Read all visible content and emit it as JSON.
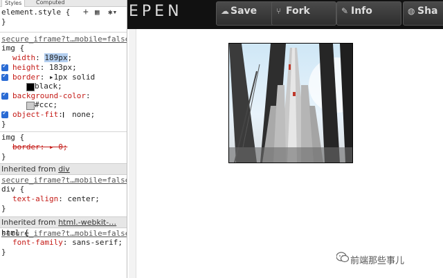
{
  "devtools": {
    "tabs": [
      "Styles",
      "Computed"
    ],
    "element_style": "element.style {",
    "icons": [
      "add-rule-icon",
      "toggle-state-icon",
      "settings-icon"
    ],
    "rule1": {
      "source": "secure_iframe?t…mobile=false",
      "selector": "img {",
      "width_prop": "width",
      "width_val": "189px",
      "height_prop": "height",
      "height_val": "183px;",
      "border_prop": "border",
      "border_val": "1px solid",
      "border_val2": "black;",
      "bg_prop": "background-color",
      "bg_val": "#ccc;",
      "fit_prop": "object-fit",
      "fit_val": "none;",
      "close": "}"
    },
    "rule2": {
      "selector": "img {",
      "prop": "border",
      "val": "0;",
      "close": "}"
    },
    "inherited1": {
      "label": "Inherited from ",
      "link": "div"
    },
    "rule3": {
      "source": "secure_iframe?t…mobile=false",
      "selector": "div {",
      "prop": "text-align",
      "val": "center;",
      "close": "}"
    },
    "inherited2": {
      "label": "Inherited from ",
      "link": "html.-webkit-…"
    },
    "rule4": {
      "source": "secure_iframe?t…mobile=false",
      "selector": "html {",
      "prop": "font-family",
      "val": "sans-serif;",
      "close": "}"
    }
  },
  "topbar": {
    "logo": "EPEN",
    "buttons": [
      {
        "label": "Save",
        "icon": "cloud-icon"
      },
      {
        "label": "Fork",
        "icon": "fork-icon"
      },
      {
        "label": "Info",
        "icon": "edit-icon"
      },
      {
        "label": "Sha",
        "icon": "globe-icon"
      }
    ]
  },
  "watermark": "前端那些事儿",
  "colors": {
    "accent": "#2a6bd4",
    "swatch_black": "#000000",
    "swatch_ccc": "#cccccc"
  }
}
